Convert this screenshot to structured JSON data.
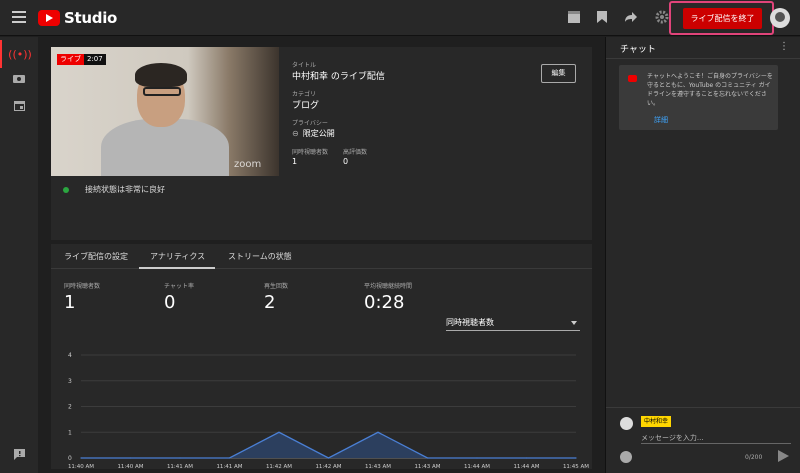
{
  "app": {
    "logo_text": "Studio"
  },
  "header": {
    "end_live_label": "ライブ配信を終了",
    "icons": [
      "clapperboard-icon",
      "bookmark-icon",
      "share-icon",
      "gear-icon"
    ]
  },
  "sidebar": {
    "items": [
      "live-icon",
      "camera-icon",
      "calendar-icon",
      "feedback-icon"
    ]
  },
  "stream": {
    "live_label": "ライブ",
    "elapsed": "2:07",
    "watermark": "zoom",
    "connection_status": "接続状態は非常に良好",
    "edit_label": "編集",
    "title_label": "タイトル",
    "title": "中村和幸 のライブ配信",
    "category_label": "カテゴリ",
    "category": "ブログ",
    "privacy_label": "プライバシー",
    "privacy": "限定公開",
    "concurrent_label": "同時視聴者数",
    "concurrent": "1",
    "likes_label": "高評価数",
    "likes": "0"
  },
  "tabs": [
    {
      "label": "ライブ配信の設定",
      "active": false
    },
    {
      "label": "アナリティクス",
      "active": true
    },
    {
      "label": "ストリームの状態",
      "active": false
    }
  ],
  "stats": [
    {
      "label": "同時視聴者数",
      "value": "1"
    },
    {
      "label": "チャット率",
      "value": "0"
    },
    {
      "label": "再生回数",
      "value": "2"
    },
    {
      "label": "平均視聴継続時間",
      "value": "0:28"
    }
  ],
  "metric_select": {
    "selected": "同時視聴者数"
  },
  "chart_data": {
    "type": "area",
    "categories": [
      "11:40 AM",
      "11:40 AM",
      "11:41 AM",
      "11:41 AM",
      "11:42 AM",
      "11:42 AM",
      "11:43 AM",
      "11:43 AM",
      "11:44 AM",
      "11:44 AM",
      "11:45 AM"
    ],
    "values": [
      0,
      0,
      0,
      0,
      1,
      0,
      1,
      0,
      0,
      0,
      0
    ],
    "ylim": [
      0,
      4
    ],
    "yticks": [
      0,
      1,
      2,
      3,
      4
    ],
    "grid": true,
    "colors": {
      "line": "#4a7fd4",
      "fill": "#2c3f5e"
    }
  },
  "chat": {
    "title": "チャット",
    "notice": "チャットへようこそ！ご自身のプライバシーを守るとともに、YouTube のコミュニティ ガイドラインを遵守することを忘れないでください。",
    "notice_link": "詳細",
    "user_name": "中村和幸",
    "input_placeholder": "メッセージを入力...",
    "char_count": "0/200"
  }
}
